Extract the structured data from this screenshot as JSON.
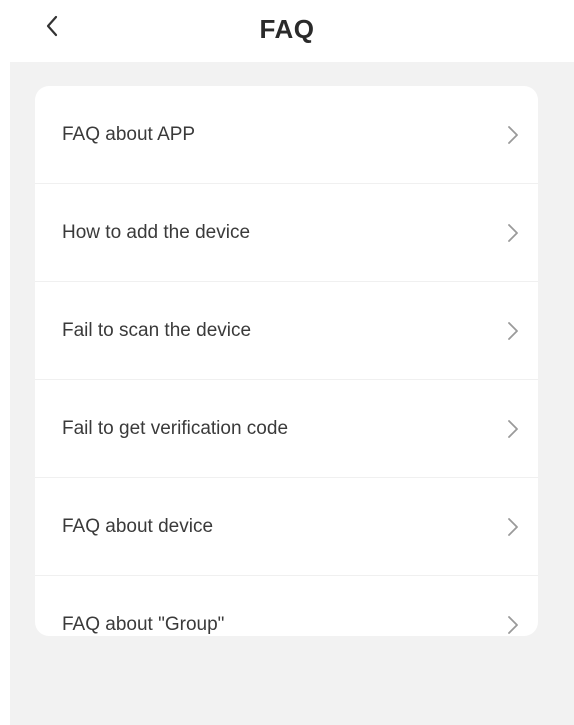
{
  "header": {
    "title": "FAQ",
    "back_icon": "chevron-left-icon"
  },
  "faq": {
    "items": [
      {
        "label": "FAQ about APP",
        "icon": "chevron-right-icon"
      },
      {
        "label": "How to add the device",
        "icon": "chevron-right-icon"
      },
      {
        "label": "Fail to scan the device",
        "icon": "chevron-right-icon"
      },
      {
        "label": "Fail to get verification code",
        "icon": "chevron-right-icon"
      },
      {
        "label": "FAQ about device",
        "icon": "chevron-right-icon"
      },
      {
        "label": "FAQ about \"Group\"",
        "icon": "chevron-right-icon"
      }
    ]
  },
  "colors": {
    "background": "#f2f2f2",
    "card": "#ffffff",
    "text": "#3a3a3a",
    "chevron": "#9a9a9a"
  }
}
